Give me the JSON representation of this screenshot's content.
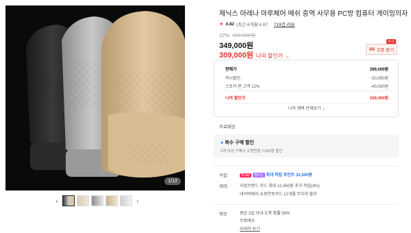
{
  "gallery": {
    "counter": "1/12",
    "prev_arrow": "‹",
    "next_arrow": "›",
    "thumb_count": 5
  },
  "product": {
    "title": "제닉스 아레나 마루체어 메쉬 중역 사무용 PC방 컴퓨터 게이밍의자",
    "rating": "4.82",
    "rating_recent": "(최근 6개월 4.87",
    "review_link": "719건 리뷰",
    "discount_rate": "22%",
    "original_price": "399,000원",
    "price": "349,000원",
    "my_price": "309,000원",
    "my_price_label": "나의 할인가",
    "coupon_label": "쿠폰 받기",
    "coupon_badge": "D-3"
  },
  "price_box": {
    "rows": [
      {
        "label": "판매가",
        "value": "399,000원"
      },
      {
        "label": "즉시할인",
        "value": "-50,000원"
      },
      {
        "label": "스토어 찐 고객 12%",
        "value": "-40,000원"
      },
      {
        "label": "나의 할인가",
        "value": "309,000원"
      }
    ],
    "more_button": "나의 혜택 전체보기 ⌄"
  },
  "shipping_badge": "무료배송",
  "multi_buy": {
    "title": "복수 구매 할인",
    "desc": "2개 이상 구매시 수량만큼 7,000원 할인"
  },
  "details": {
    "points_label": "적립",
    "points_badge": "N pay",
    "points_sub": "멤버십",
    "points_value": "최대 적립 포인트 32,000원",
    "benefit_label": "혜택",
    "benefit_line1": "리빙브랜드 카드 최대 12,360원 추가 적립(4%)",
    "benefit_line2": "네이버페이 쇼핑연동카드 12개월 무이자 할부",
    "delivery_label": "배송",
    "delivery_line1": "평균 2일 이내 도착 확률 90%",
    "delivery_line2": "무료배송",
    "delivery_link": "자세히 보기"
  },
  "colors": {
    "accent_red": "#e8322c",
    "points_blue": "#2a73e8",
    "npay_pink": "#ff1e56"
  }
}
